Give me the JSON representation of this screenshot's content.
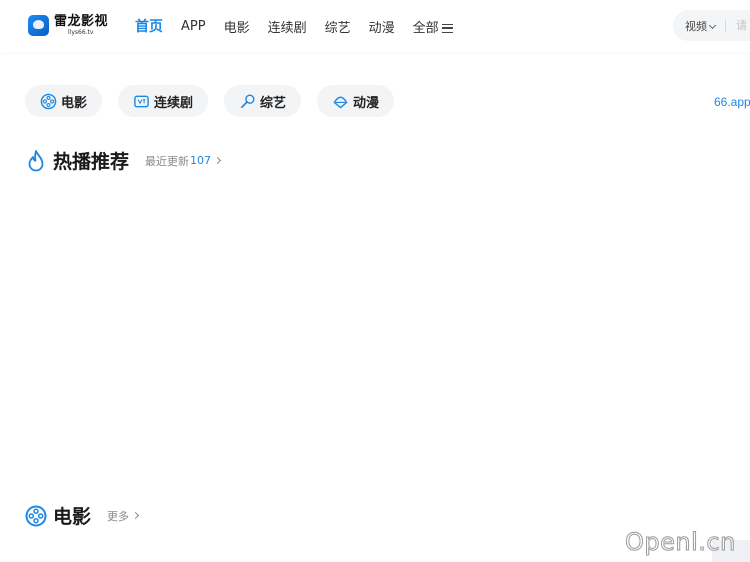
{
  "header": {
    "logo_title": "雷龙影视",
    "logo_sub": "llys66.tv",
    "nav": [
      {
        "label": "首页",
        "active": true
      },
      {
        "label": "APP"
      },
      {
        "label": "电影"
      },
      {
        "label": "连续剧"
      },
      {
        "label": "综艺"
      },
      {
        "label": "动漫"
      },
      {
        "label": "全部"
      }
    ],
    "search_select": "视频",
    "search_placeholder": "请"
  },
  "categories": [
    {
      "label": "电影",
      "icon": "film-reel-icon"
    },
    {
      "label": "连续剧",
      "icon": "tv-icon"
    },
    {
      "label": "综艺",
      "icon": "microphone-icon"
    },
    {
      "label": "动漫",
      "icon": "anime-icon"
    }
  ],
  "promo_text": "66.app",
  "hot_section": {
    "title": "热播推荐",
    "sub_label": "最近更新",
    "count": "107"
  },
  "movie_section": {
    "title": "电影",
    "more_label": "更多"
  },
  "watermark": "Openl.cn",
  "colors": {
    "accent": "#1e88e5",
    "pill_bg": "#f3f4f6"
  }
}
